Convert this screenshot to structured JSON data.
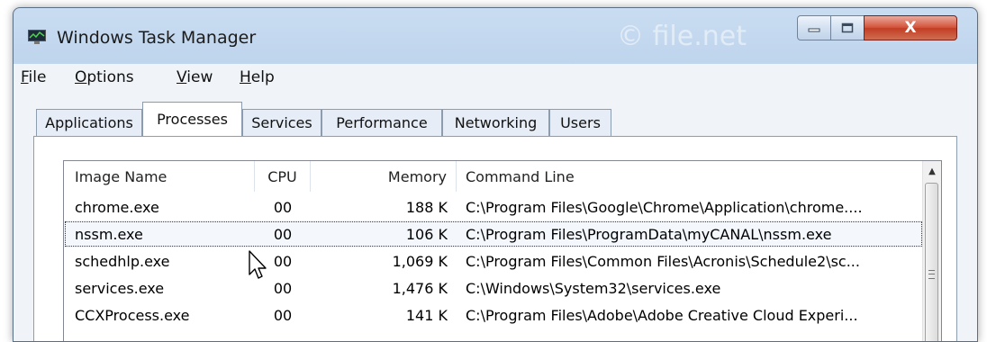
{
  "window": {
    "title": "Windows Task Manager",
    "watermark": "© file.net",
    "close_label": "X"
  },
  "menu": [
    {
      "underline": "F",
      "rest": "ile"
    },
    {
      "underline": "O",
      "rest": "ptions"
    },
    {
      "underline": "V",
      "rest": "iew"
    },
    {
      "underline": "H",
      "rest": "elp"
    }
  ],
  "tabs": [
    "Applications",
    "Processes",
    "Services",
    "Performance",
    "Networking",
    "Users"
  ],
  "active_tab": "Processes",
  "table": {
    "columns": [
      "Image Name",
      "CPU",
      "Memory",
      "Command Line"
    ],
    "rows": [
      {
        "name": "chrome.exe",
        "cpu": "00",
        "memory": "188 K",
        "cmd": "C:\\Program Files\\Google\\Chrome\\Application\\chrome...."
      },
      {
        "name": "nssm.exe",
        "cpu": "00",
        "memory": "106 K",
        "cmd": "C:\\Program Files\\ProgramData\\myCANAL\\nssm.exe"
      },
      {
        "name": "schedhlp.exe",
        "cpu": "00",
        "memory": "1,069 K",
        "cmd": "C:\\Program Files\\Common Files\\Acronis\\Schedule2\\sc..."
      },
      {
        "name": "services.exe",
        "cpu": "00",
        "memory": "1,476 K",
        "cmd": "C:\\Windows\\System32\\services.exe"
      },
      {
        "name": "CCXProcess.exe",
        "cpu": "00",
        "memory": "141 K",
        "cmd": "C:\\Program Files\\Adobe\\Adobe Creative Cloud Experi..."
      }
    ],
    "selected_row": "nssm.exe"
  },
  "icons": {
    "app": "task-manager-icon",
    "minimize": "minimize-icon",
    "maximize": "maximize-icon",
    "close": "close-icon",
    "scroll_up": "scroll-up-arrow-icon",
    "cursor": "mouse-pointer-icon"
  },
  "colors": {
    "title_bar": "#b6cfe9",
    "close_button": "#c23d24",
    "selection_outline": "#3a3a3a"
  }
}
